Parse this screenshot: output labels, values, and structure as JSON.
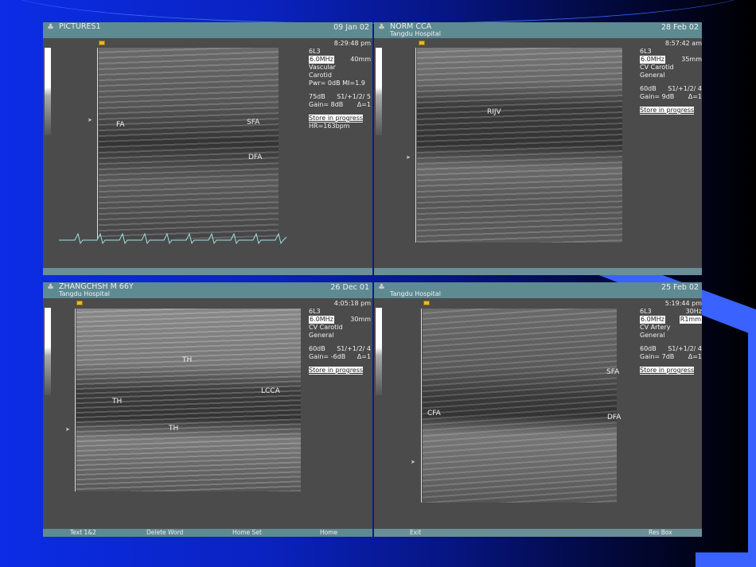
{
  "panels": [
    {
      "title": "PICTURES1",
      "subtitle": "",
      "date": "09 Jan 02",
      "time": "8:29:48 pm",
      "probe": "6L3",
      "freq": "6.0MHz",
      "depth": "40mm",
      "preset1": "Vascular",
      "preset2": "Carotid",
      "pwr": "Pwr=   0dB  MI=1.9",
      "db": "75dB",
      "settings": "S1/+1/2/ 5",
      "gain": "Gain=   8dB",
      "delta": "Δ=1",
      "status": "Store in progress",
      "hr": "HR=163bpm",
      "labels": [
        "FA",
        "SFA",
        "DFA"
      ]
    },
    {
      "title": "NORM     CCA",
      "subtitle": "Tangdu  Hospital",
      "date": "28 Feb 02",
      "time": "8:57:42 am",
      "probe": "6L3",
      "freq": "6.0MHz",
      "depth": "35mm",
      "preset1": "CV Carotid",
      "preset2": "General",
      "db": "60dB",
      "settings": "S1/+1/2/ 4",
      "gain": "Gain=   9dB",
      "delta": "Δ=1",
      "status": "Store in progress",
      "labels": [
        "RIJV"
      ]
    },
    {
      "title": "ZHANGCHSH   M   66Y",
      "subtitle": "Tangdu  Hospital",
      "date": "26 Dec 01",
      "time": "4:05:18 pm",
      "probe": "6L3",
      "freq": "6.0MHz",
      "depth": "30mm",
      "preset1": "CV Carotid",
      "preset2": "General",
      "db": "60dB",
      "settings": "S1/+1/2/ 4",
      "gain": "Gain=  -6dB",
      "delta": "Δ=1",
      "status": "Store in progress",
      "labels": [
        "TH",
        "TH",
        "LCCA",
        "TH"
      ]
    },
    {
      "title": "",
      "subtitle": "Tangdu  Hospital",
      "date": "25 Feb 02",
      "time": "5:19:44 pm",
      "probe": "6L3",
      "rate": "30Hz",
      "freq": "6.0MHz",
      "depth": "R1mm",
      "preset1": "CV Artery",
      "preset2": "General",
      "db": "60dB",
      "settings": "S1/+1/2/ 4",
      "gain": "Gain=   7dB",
      "delta": "Δ=1",
      "status": "Store in progress",
      "labels": [
        "SFA",
        "CFA",
        "DFA"
      ]
    }
  ],
  "footer": {
    "left": [
      "Text 1&2",
      "Delete Word",
      "Home Set",
      "Home"
    ],
    "right": [
      "Exit",
      "Res Box"
    ]
  },
  "colors": {
    "header": "#5e8a92",
    "body": "#4b4b4b",
    "ecg": "#9fe0e0"
  }
}
